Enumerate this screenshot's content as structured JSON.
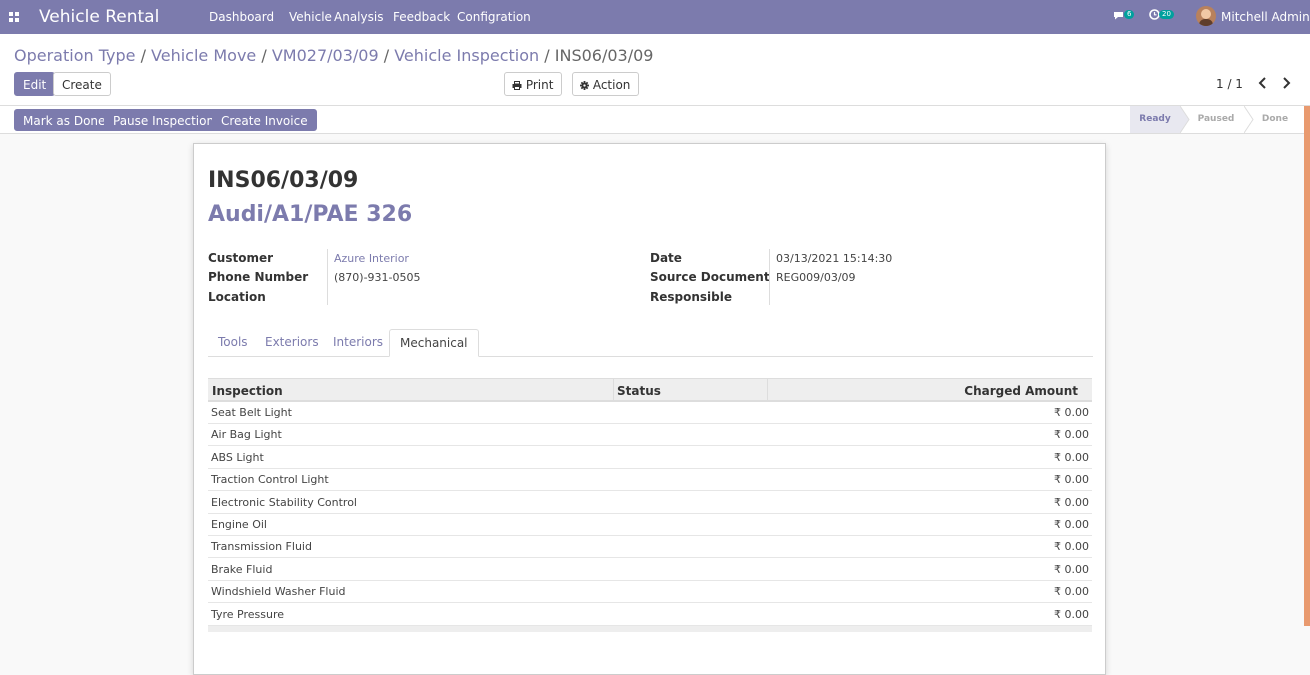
{
  "navbar": {
    "app_name": "Vehicle Rental",
    "menu": [
      "Dashboard",
      "Vehicle",
      "Analysis",
      "Feedback",
      "Configration"
    ],
    "chat_count": "6",
    "activity_count": "20",
    "user_name": "Mitchell Admin",
    "icons": [
      "apps-icon",
      "chat-icon",
      "clock-icon",
      "avatar"
    ]
  },
  "control_panel": {
    "breadcrumb": [
      "Operation Type",
      "Vehicle Move",
      "VM027/03/09",
      "Vehicle Inspection"
    ],
    "breadcrumb_current": "INS06/03/09",
    "edit_label": "Edit",
    "create_label": "Create",
    "print_label": "Print",
    "action_label": "Action",
    "pager": "1 / 1"
  },
  "statusbar": {
    "buttons": [
      "Mark as Done",
      "Pause Inspection",
      "Create Invoice"
    ],
    "steps": [
      "Ready",
      "Paused",
      "Done"
    ],
    "current_step": "Ready"
  },
  "record": {
    "name": "INS06/03/09",
    "vehicle": "Audi/A1/PAE 326",
    "left_fields": [
      {
        "label": "Customer",
        "value": "Azure Interior"
      },
      {
        "label": "Phone Number",
        "value": "(870)-931-0505"
      },
      {
        "label": "Location",
        "value": ""
      }
    ],
    "right_fields": [
      {
        "label": "Date",
        "value": "03/13/2021 15:14:30"
      },
      {
        "label": "Source Document",
        "value": "REG009/03/09"
      },
      {
        "label": "Responsible",
        "value": ""
      }
    ]
  },
  "tabs": [
    "Tools",
    "Exteriors",
    "Interiors",
    "Mechanical"
  ],
  "active_tab": "Mechanical",
  "table": {
    "columns": [
      "Inspection",
      "Status",
      "Charged Amount"
    ],
    "rows": [
      {
        "name": "Seat Belt Light",
        "status": "",
        "amount": "₹ 0.00"
      },
      {
        "name": "Air Bag Light",
        "status": "",
        "amount": "₹ 0.00"
      },
      {
        "name": "ABS Light",
        "status": "",
        "amount": "₹ 0.00"
      },
      {
        "name": "Traction Control Light",
        "status": "",
        "amount": "₹ 0.00"
      },
      {
        "name": "Electronic Stability Control",
        "status": "",
        "amount": "₹ 0.00"
      },
      {
        "name": "Engine Oil",
        "status": "",
        "amount": "₹ 0.00"
      },
      {
        "name": "Transmission Fluid",
        "status": "",
        "amount": "₹ 0.00"
      },
      {
        "name": "Brake Fluid",
        "status": "",
        "amount": "₹ 0.00"
      },
      {
        "name": "Windshield Washer Fluid",
        "status": "",
        "amount": "₹ 0.00"
      },
      {
        "name": "Tyre Pressure",
        "status": "",
        "amount": "₹ 0.00"
      }
    ]
  },
  "colors": {
    "brand": "#7c7bad",
    "badge": "#00a09d",
    "scroll_indicator": "#e99a6f"
  }
}
